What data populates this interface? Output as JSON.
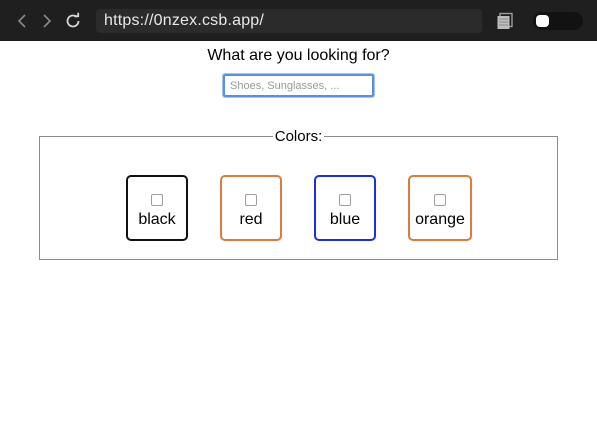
{
  "browser": {
    "url": "https://0nzex.csb.app/",
    "back_icon": "chevron-left-icon",
    "forward_icon": "chevron-right-icon",
    "reload_icon": "reload-icon",
    "extension_icon": "extensions-icon"
  },
  "search": {
    "question": "What are you looking for?",
    "placeholder": "Shoes, Sunglasses, ...",
    "value": ""
  },
  "colors": {
    "legend": "Colors:",
    "options": [
      {
        "label": "black",
        "border_color": "#111111",
        "checked": false
      },
      {
        "label": "red",
        "border_color": "#e07a3a",
        "checked": false
      },
      {
        "label": "blue",
        "border_color": "#1c2fe0",
        "checked": false
      },
      {
        "label": "orange",
        "border_color": "#e07a3a",
        "checked": false
      }
    ]
  }
}
